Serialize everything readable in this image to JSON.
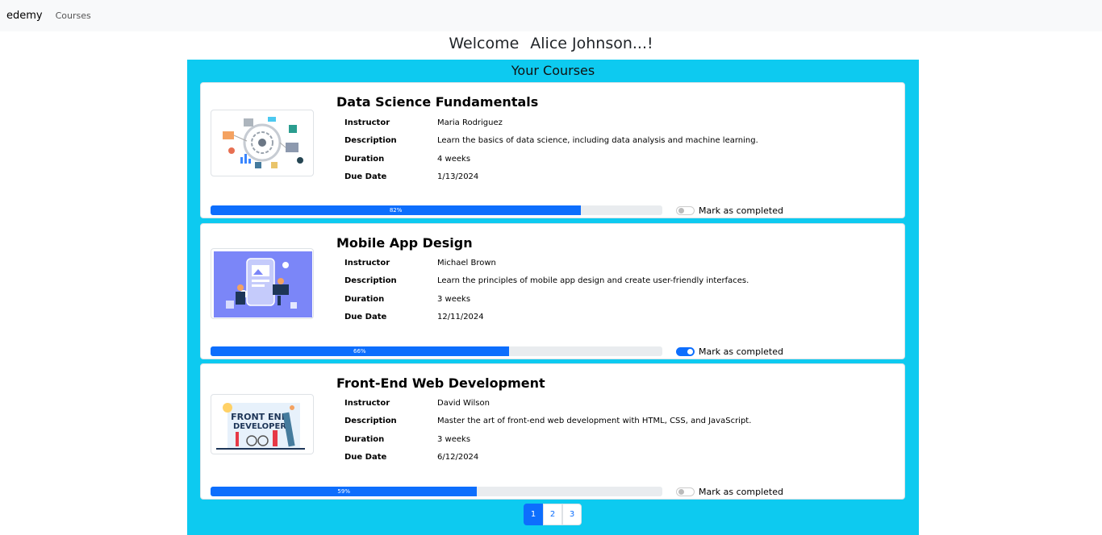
{
  "nav": {
    "brand": "edemy",
    "link_courses": "Courses"
  },
  "welcome": {
    "greeting": "Welcome",
    "user_name": "Alice Johnson...!"
  },
  "panel": {
    "title": "Your Courses"
  },
  "labels": {
    "instructor": "Instructor",
    "description": "Description",
    "duration": "Duration",
    "due_date": "Due Date",
    "mark_completed": "Mark as completed"
  },
  "courses": [
    {
      "title": "Data Science Fundamentals",
      "instructor": "Maria Rodriguez",
      "description": "Learn the basics of data science, including data analysis and machine learning.",
      "duration": "4 weeks",
      "due_date": "1/13/2024",
      "progress_label": "82%",
      "progress": 82,
      "completed": false
    },
    {
      "title": "Mobile App Design",
      "instructor": "Michael Brown",
      "description": "Learn the principles of mobile app design and create user-friendly interfaces.",
      "duration": "3 weeks",
      "due_date": "12/11/2024",
      "progress_label": "66%",
      "progress": 66,
      "completed": true
    },
    {
      "title": "Front-End Web Development",
      "instructor": "David Wilson",
      "description": "Master the art of front-end web development with HTML, CSS, and JavaScript.",
      "duration": "3 weeks",
      "due_date": "6/12/2024",
      "progress_label": "59%",
      "progress": 59,
      "completed": false
    }
  ],
  "thumb3_text": {
    "line1": "FRONT END",
    "line2": "DEVELOPER"
  },
  "pagination": {
    "p1": "1",
    "p2": "2",
    "p3": "3"
  },
  "colors": {
    "panel": "#0dcaf0",
    "primary": "#0d6efd",
    "thumb2_bg": "#7b86f8"
  }
}
